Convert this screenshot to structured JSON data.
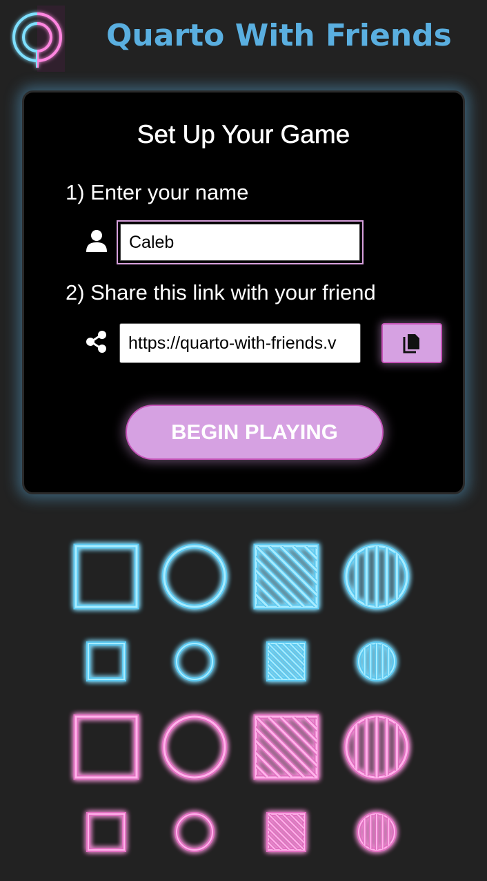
{
  "app": {
    "title": "Quarto With Friends"
  },
  "setup": {
    "title": "Set Up Your Game",
    "step1_label": "1) Enter your name",
    "step2_label": "2) Share this link with your friend",
    "name_value": "Caleb",
    "share_link": "https://quarto-with-friends.v",
    "begin_label": "BEGIN PLAYING"
  },
  "icons": {
    "logo": "neon-q-logo-icon",
    "user": "user-icon",
    "share": "share-icon",
    "copy": "copy-icon"
  },
  "colors": {
    "background": "#222222",
    "title_blue": "#5aafe0",
    "button_purple": "#d6a1e2",
    "neon_blue": "#5cc8f0",
    "neon_pink": "#e070c0"
  },
  "pieces": [
    {
      "color": "blue",
      "size": "large",
      "shape": "square",
      "fill": "hollow"
    },
    {
      "color": "blue",
      "size": "large",
      "shape": "circle",
      "fill": "hollow"
    },
    {
      "color": "blue",
      "size": "large",
      "shape": "square",
      "fill": "striped"
    },
    {
      "color": "blue",
      "size": "large",
      "shape": "circle",
      "fill": "striped"
    },
    {
      "color": "blue",
      "size": "small",
      "shape": "square",
      "fill": "hollow"
    },
    {
      "color": "blue",
      "size": "small",
      "shape": "circle",
      "fill": "hollow"
    },
    {
      "color": "blue",
      "size": "small",
      "shape": "square",
      "fill": "striped"
    },
    {
      "color": "blue",
      "size": "small",
      "shape": "circle",
      "fill": "striped"
    },
    {
      "color": "pink",
      "size": "large",
      "shape": "square",
      "fill": "hollow"
    },
    {
      "color": "pink",
      "size": "large",
      "shape": "circle",
      "fill": "hollow"
    },
    {
      "color": "pink",
      "size": "large",
      "shape": "square",
      "fill": "striped"
    },
    {
      "color": "pink",
      "size": "large",
      "shape": "circle",
      "fill": "striped"
    },
    {
      "color": "pink",
      "size": "small",
      "shape": "square",
      "fill": "hollow"
    },
    {
      "color": "pink",
      "size": "small",
      "shape": "circle",
      "fill": "hollow"
    },
    {
      "color": "pink",
      "size": "small",
      "shape": "square",
      "fill": "striped"
    },
    {
      "color": "pink",
      "size": "small",
      "shape": "circle",
      "fill": "striped"
    }
  ]
}
